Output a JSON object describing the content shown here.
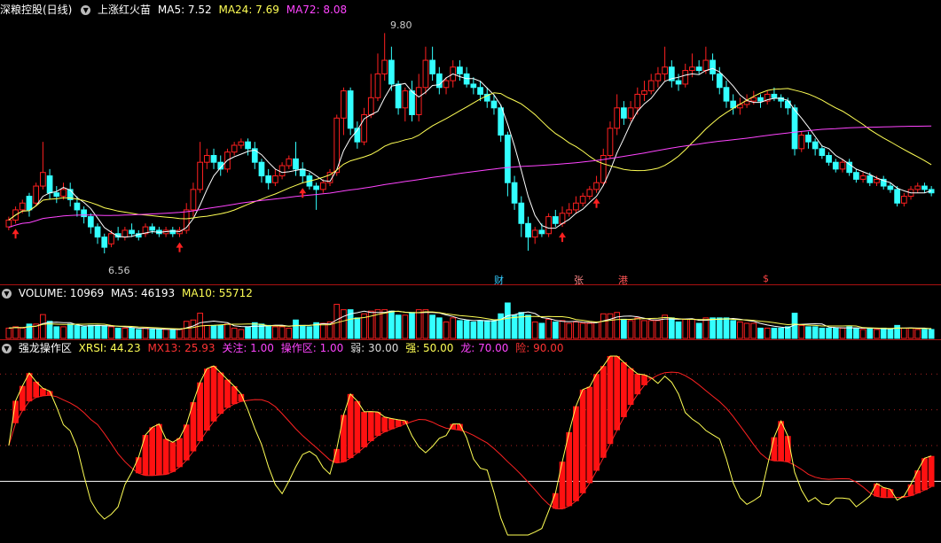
{
  "price_panel": {
    "stock_name": "深粮控股(日线)",
    "indicator": "上涨红火苗",
    "ma5_label": "MA5: 7.52",
    "ma24_label": "MA24: 7.69",
    "ma72_label": "MA72: 8.08",
    "high_label": "9.80",
    "low_label": "6.56",
    "markers": [
      "财",
      "张",
      "港",
      "$"
    ],
    "colors": {
      "ma5": "#ffffff",
      "ma24": "#ffff55",
      "ma72": "#ff44ff",
      "up": "#ff2020",
      "down": "#33ffff"
    }
  },
  "volume_panel": {
    "title": "VOLUME: 10969",
    "ma5_label": "MA5: 46193",
    "ma10_label": "MA10: 55712"
  },
  "xrsi_panel": {
    "title": "强龙操作区",
    "xrsi_label": "XRSI: 44.23",
    "mx13_label": "MX13: 25.93",
    "guanzhu_label": "关注: 1.00",
    "caozuo_label": "操作区: 1.00",
    "ruo_label": "弱: 30.00",
    "qiang_label": "强: 50.00",
    "long_label": "龙: 70.00",
    "xian_label": "险: 90.00"
  },
  "chart_data": {
    "type": "candlestick",
    "price_range": [
      6.3,
      10.0
    ],
    "ma5_last": 7.52,
    "ma24_last": 7.69,
    "ma72_last": 8.08,
    "annotated_high": 9.8,
    "annotated_low": 6.56,
    "candles": [
      [
        6.95,
        7.05,
        7.1,
        6.9
      ],
      [
        7.05,
        7.2,
        7.25,
        7.0
      ],
      [
        7.2,
        7.3,
        7.35,
        7.15
      ],
      [
        7.4,
        7.2,
        7.45,
        7.1
      ],
      [
        7.3,
        7.55,
        7.6,
        7.25
      ],
      [
        7.55,
        7.75,
        8.2,
        7.5
      ],
      [
        7.7,
        7.45,
        7.8,
        7.35
      ],
      [
        7.45,
        7.4,
        7.55,
        7.3
      ],
      [
        7.4,
        7.5,
        7.6,
        7.35
      ],
      [
        7.5,
        7.35,
        7.6,
        7.25
      ],
      [
        7.3,
        7.2,
        7.4,
        7.1
      ],
      [
        7.2,
        7.1,
        7.25,
        7.0
      ],
      [
        7.1,
        6.95,
        7.15,
        6.85
      ],
      [
        6.95,
        6.8,
        7.0,
        6.7
      ],
      [
        6.8,
        6.65,
        6.85,
        6.56
      ],
      [
        6.7,
        6.85,
        6.9,
        6.65
      ],
      [
        6.85,
        6.8,
        6.95,
        6.75
      ],
      [
        6.8,
        6.9,
        6.95,
        6.75
      ],
      [
        6.9,
        6.85,
        7.0,
        6.8
      ],
      [
        6.85,
        6.8,
        6.9,
        6.75
      ],
      [
        6.85,
        6.95,
        7.0,
        6.8
      ],
      [
        6.95,
        6.9,
        7.0,
        6.85
      ],
      [
        6.9,
        6.85,
        6.95,
        6.8
      ],
      [
        6.85,
        6.9,
        6.95,
        6.8
      ],
      [
        6.9,
        6.85,
        6.95,
        6.8
      ],
      [
        6.85,
        6.9,
        6.95,
        6.8
      ],
      [
        6.9,
        7.2,
        7.3,
        6.85
      ],
      [
        7.2,
        7.5,
        7.6,
        7.1
      ],
      [
        7.5,
        7.9,
        8.2,
        7.45
      ],
      [
        7.9,
        8.0,
        8.1,
        7.8
      ],
      [
        8.0,
        7.9,
        8.1,
        7.8
      ],
      [
        7.9,
        7.8,
        8.0,
        7.7
      ],
      [
        7.8,
        8.05,
        8.1,
        7.75
      ],
      [
        8.05,
        8.15,
        8.2,
        8.0
      ],
      [
        8.15,
        8.2,
        8.25,
        8.1
      ],
      [
        8.2,
        8.1,
        8.25,
        8.0
      ],
      [
        8.1,
        7.9,
        8.2,
        7.8
      ],
      [
        7.9,
        7.7,
        7.95,
        7.6
      ],
      [
        7.7,
        7.6,
        7.8,
        7.5
      ],
      [
        7.6,
        7.7,
        7.8,
        7.55
      ],
      [
        7.7,
        7.85,
        7.9,
        7.65
      ],
      [
        7.85,
        7.95,
        8.0,
        7.8
      ],
      [
        7.95,
        7.8,
        8.2,
        7.7
      ],
      [
        7.8,
        7.7,
        7.9,
        7.6
      ],
      [
        7.7,
        7.55,
        7.75,
        7.5
      ],
      [
        7.55,
        7.5,
        7.6,
        7.2
      ],
      [
        7.5,
        7.6,
        7.65,
        7.45
      ],
      [
        7.6,
        7.75,
        7.8,
        7.55
      ],
      [
        7.75,
        8.55,
        8.6,
        7.7
      ],
      [
        8.55,
        8.95,
        9.0,
        8.3
      ],
      [
        8.95,
        8.4,
        9.0,
        8.3
      ],
      [
        8.4,
        8.2,
        8.5,
        8.1
      ],
      [
        8.2,
        8.6,
        8.7,
        8.15
      ],
      [
        8.6,
        8.85,
        9.2,
        8.55
      ],
      [
        8.85,
        9.2,
        9.5,
        8.8
      ],
      [
        9.2,
        9.4,
        9.8,
        9.1
      ],
      [
        9.4,
        9.05,
        9.6,
        8.95
      ],
      [
        9.05,
        8.7,
        9.1,
        8.6
      ],
      [
        8.7,
        8.95,
        9.0,
        8.5
      ],
      [
        8.95,
        8.6,
        9.1,
        8.5
      ],
      [
        8.6,
        9.0,
        9.2,
        8.5
      ],
      [
        9.0,
        9.4,
        9.6,
        8.9
      ],
      [
        9.4,
        9.2,
        9.6,
        9.1
      ],
      [
        9.2,
        9.0,
        9.3,
        8.9
      ],
      [
        9.0,
        9.1,
        9.15,
        8.9
      ],
      [
        9.1,
        9.3,
        9.4,
        9.0
      ],
      [
        9.3,
        9.2,
        9.4,
        9.1
      ],
      [
        9.2,
        9.05,
        9.3,
        9.0
      ],
      [
        9.05,
        9.0,
        9.15,
        8.9
      ],
      [
        9.0,
        8.9,
        9.1,
        8.8
      ],
      [
        8.9,
        8.8,
        9.0,
        8.7
      ],
      [
        8.8,
        8.7,
        8.9,
        8.6
      ],
      [
        8.7,
        8.3,
        8.75,
        8.2
      ],
      [
        8.3,
        7.6,
        8.35,
        7.4
      ],
      [
        7.6,
        7.3,
        7.7,
        7.2
      ],
      [
        7.3,
        7.0,
        7.4,
        6.8
      ],
      [
        7.0,
        6.8,
        7.1,
        6.6
      ],
      [
        6.8,
        6.9,
        6.95,
        6.7
      ],
      [
        6.9,
        6.85,
        7.0,
        6.8
      ],
      [
        6.85,
        7.1,
        7.15,
        6.8
      ],
      [
        7.1,
        7.0,
        7.2,
        6.95
      ],
      [
        7.0,
        7.15,
        7.25,
        6.95
      ],
      [
        7.15,
        7.2,
        7.3,
        7.1
      ],
      [
        7.2,
        7.3,
        7.4,
        7.15
      ],
      [
        7.3,
        7.4,
        7.45,
        7.25
      ],
      [
        7.4,
        7.5,
        7.55,
        7.35
      ],
      [
        7.5,
        7.6,
        7.7,
        7.45
      ],
      [
        7.6,
        8.0,
        8.1,
        7.55
      ],
      [
        8.0,
        8.4,
        8.5,
        7.95
      ],
      [
        8.4,
        8.7,
        8.9,
        8.3
      ],
      [
        8.7,
        8.55,
        8.8,
        8.45
      ],
      [
        8.55,
        8.7,
        8.8,
        8.5
      ],
      [
        8.7,
        8.9,
        9.0,
        8.6
      ],
      [
        8.9,
        8.95,
        9.1,
        8.8
      ],
      [
        8.95,
        9.1,
        9.2,
        8.9
      ],
      [
        9.1,
        9.2,
        9.3,
        9.0
      ],
      [
        9.2,
        9.3,
        9.6,
        9.1
      ],
      [
        9.3,
        9.1,
        9.4,
        9.0
      ],
      [
        9.1,
        9.05,
        9.2,
        8.95
      ],
      [
        9.05,
        9.25,
        9.35,
        9.0
      ],
      [
        9.25,
        9.3,
        9.5,
        9.15
      ],
      [
        9.3,
        9.25,
        9.4,
        9.2
      ],
      [
        9.25,
        9.4,
        9.6,
        9.2
      ],
      [
        9.4,
        9.2,
        9.5,
        9.1
      ],
      [
        9.2,
        9.0,
        9.3,
        8.9
      ],
      [
        9.0,
        8.8,
        9.1,
        8.7
      ],
      [
        8.8,
        8.7,
        8.9,
        8.6
      ],
      [
        8.7,
        8.75,
        8.85,
        8.6
      ],
      [
        8.75,
        8.8,
        8.9,
        8.7
      ],
      [
        8.8,
        8.85,
        8.95,
        8.75
      ],
      [
        8.85,
        8.8,
        8.9,
        8.7
      ],
      [
        8.8,
        8.9,
        8.95,
        8.75
      ],
      [
        8.9,
        8.85,
        9.0,
        8.8
      ],
      [
        8.85,
        8.8,
        8.9,
        8.7
      ],
      [
        8.8,
        8.7,
        8.85,
        8.6
      ],
      [
        8.7,
        8.1,
        8.75,
        8.0
      ],
      [
        8.1,
        8.3,
        8.35,
        8.05
      ],
      [
        8.3,
        8.2,
        8.35,
        8.1
      ],
      [
        8.2,
        8.1,
        8.25,
        8.0
      ],
      [
        8.1,
        8.0,
        8.15,
        7.95
      ],
      [
        8.0,
        7.9,
        8.05,
        7.85
      ],
      [
        7.9,
        7.8,
        7.95,
        7.75
      ],
      [
        7.8,
        7.9,
        7.95,
        7.75
      ],
      [
        7.9,
        7.75,
        7.95,
        7.7
      ],
      [
        7.75,
        7.65,
        7.8,
        7.6
      ],
      [
        7.65,
        7.7,
        7.75,
        7.6
      ],
      [
        7.7,
        7.6,
        7.75,
        7.55
      ],
      [
        7.6,
        7.65,
        7.7,
        7.55
      ],
      [
        7.65,
        7.55,
        7.7,
        7.5
      ],
      [
        7.55,
        7.5,
        7.6,
        7.45
      ],
      [
        7.5,
        7.3,
        7.55,
        7.25
      ],
      [
        7.3,
        7.4,
        7.45,
        7.25
      ],
      [
        7.4,
        7.5,
        7.55,
        7.35
      ],
      [
        7.5,
        7.55,
        7.6,
        7.45
      ],
      [
        7.55,
        7.5,
        7.6,
        7.45
      ],
      [
        7.5,
        7.45,
        7.55,
        7.4
      ]
    ],
    "volume_note": "histogram below price, red = up day, cyan = down day",
    "xrsi_levels": {
      "弱": 30,
      "强": 50,
      "龙": 70,
      "险": 90
    },
    "xrsi_last": 44.23,
    "mx13_last": 25.93
  }
}
